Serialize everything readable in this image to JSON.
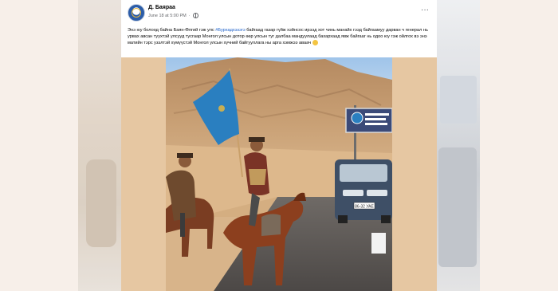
{
  "post": {
    "author": "Д. Баяраа",
    "date": "June 18 at 5:00 PM",
    "text_before_tag": "Энэ юу болоод байна Баян-Өлгий гэж улс ",
    "hashtag": "#Бурхадхэзэгэ",
    "text_after_tag": " байгаад газар гүйж хэйнсос ирээд хот чинь манайх гээд байгаамуу дарван ч генерал нь урвах авсан туухтэй улсууд тусгаар Монгол улсын дотор өөр улсын туг далбаа мандуулаад бахархаад явж байгааг нь одоо юу гэж ойлгох вэ энэ матийн тэрс узэлтэй хүмүүстэй Монгол улсын хүчний байгууллага ны арга хэмжээ аваач"
  },
  "video": {
    "sign_text": "",
    "van_plate": "86-32 УАЕ"
  },
  "colors": {
    "hashtag": "#1b5fc9",
    "flag": "#2a7fc0",
    "emblem": "#e4b640"
  }
}
